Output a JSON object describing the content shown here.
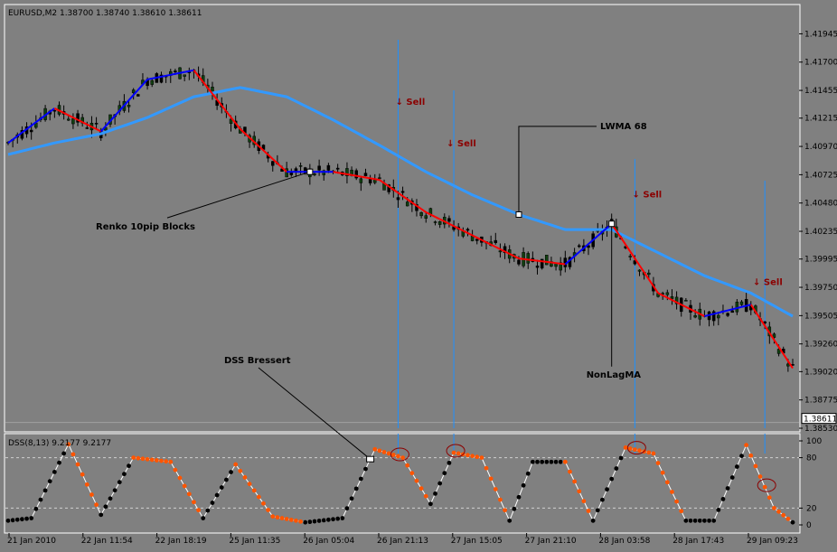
{
  "chart_data": [
    {
      "type": "candlestick",
      "title": "EURUSD,M2  1.38700 1.38740 1.38610 1.38611",
      "ylim": [
        1.3853,
        1.4205
      ],
      "price_ticks": [
        "1.41945",
        "1.41700",
        "1.41455",
        "1.41215",
        "1.40970",
        "1.40725",
        "1.40480",
        "1.40235",
        "1.39995",
        "1.39750",
        "1.39505",
        "1.39260",
        "1.39020",
        "1.38775",
        "1.38530"
      ],
      "current_price": "1.38611",
      "colors": {
        "bull": "#104010",
        "bear": "#000000",
        "nonlag_down": "#ff0000",
        "nonlag_up": "#0000ff",
        "lwma": "#3399ff",
        "marker": "#1e90ff",
        "sell": "#8b0000"
      },
      "series": [
        {
          "name": "Renko 10pip Blocks",
          "type": "candlestick",
          "count": 170,
          "close_start": 1.409,
          "close_end": 1.3866
        },
        {
          "name": "NonLagMA",
          "type": "line",
          "x": [
            0,
            10,
            20,
            30,
            40,
            50,
            60,
            70,
            80,
            90,
            100,
            110,
            120,
            130,
            140,
            150,
            160,
            169
          ],
          "values": [
            1.41,
            1.413,
            1.411,
            1.4155,
            1.4163,
            1.4112,
            1.4075,
            1.4075,
            1.4068,
            1.404,
            1.402,
            1.4,
            1.3995,
            1.403,
            1.397,
            1.395,
            1.396,
            1.3905
          ]
        },
        {
          "name": "LWMA 68",
          "type": "line",
          "x": [
            0,
            10,
            20,
            30,
            40,
            50,
            60,
            70,
            80,
            90,
            100,
            110,
            120,
            130,
            140,
            150,
            160,
            169
          ],
          "values": [
            1.409,
            1.41,
            1.4108,
            1.4122,
            1.414,
            1.4148,
            1.414,
            1.412,
            1.4098,
            1.4075,
            1.4055,
            1.4038,
            1.4025,
            1.4025,
            1.4005,
            1.3985,
            1.397,
            1.395
          ]
        }
      ],
      "sell_signals": [
        {
          "label": "↓ Sell",
          "x": 85,
          "price": 1.4133
        },
        {
          "label": "↓ Sell",
          "x": 96,
          "price": 1.4097
        },
        {
          "label": "↓ Sell",
          "x": 136,
          "price": 1.4053
        },
        {
          "label": "↓ Sell",
          "x": 162,
          "price": 1.3977
        }
      ],
      "signal_lines_x": [
        84,
        96,
        135,
        163
      ],
      "annotations": [
        {
          "text": "LWMA 68",
          "x": 110,
          "price": 1.4112
        },
        {
          "text": "Renko 10pip Blocks",
          "x": 65,
          "price": 1.4025
        },
        {
          "text": "NonLagMA",
          "x": 130,
          "price": 1.3897
        }
      ]
    },
    {
      "type": "line",
      "title": "DSS(8,13) 9.2177 9.2177",
      "ylim": [
        0,
        100
      ],
      "yticks": [
        100,
        80,
        20,
        0
      ],
      "levels": [
        80,
        20
      ],
      "colors": {
        "line": "#ffffff",
        "rising": "#000000",
        "falling": "#ff5500",
        "circle": "#8b0000"
      },
      "series": [
        {
          "name": "DSS Bressert",
          "x": [
            0,
            5,
            13,
            20,
            27,
            35,
            42,
            49,
            57,
            64,
            72,
            79,
            85,
            91,
            96,
            102,
            108,
            113,
            120,
            126,
            133,
            139,
            146,
            152,
            159,
            165,
            169
          ],
          "values": [
            5,
            8,
            96,
            12,
            80,
            75,
            8,
            72,
            10,
            3,
            8,
            90,
            80,
            25,
            86,
            80,
            5,
            75,
            75,
            5,
            92,
            85,
            5,
            5,
            95,
            20,
            3
          ]
        }
      ],
      "circled_x": [
        84,
        96,
        135,
        163
      ],
      "annotations": [
        {
          "text": "DSS Bressert",
          "x": 78
        }
      ]
    }
  ],
  "time_labels": [
    "21 Jan 2010",
    "22 Jan 11:54",
    "22 Jan 18:19",
    "25 Jan 11:35",
    "26 Jan 05:04",
    "26 Jan 21:13",
    "27 Jan 15:05",
    "27 Jan 21:10",
    "28 Jan 03:58",
    "28 Jan 17:43",
    "29 Jan 09:23"
  ]
}
